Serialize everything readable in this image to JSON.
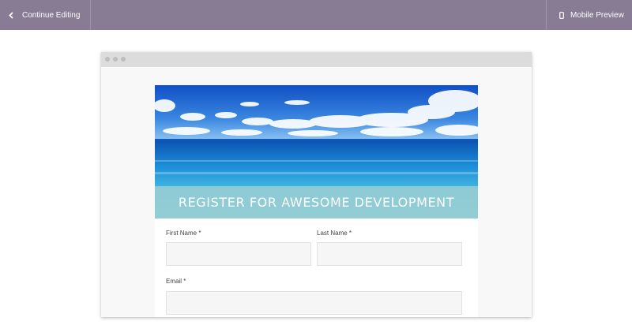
{
  "topbar": {
    "continue_label": "Continue Editing",
    "mobile_label": "Mobile Preview",
    "background": "#877c94",
    "left_icon": "chevron-left-icon",
    "right_icon": "mobile-phone-icon"
  },
  "form": {
    "banner_title": "REGISTER FOR AWESOME DEVELOPMENT",
    "banner_color": "#92cbd3",
    "fields": {
      "first_name": {
        "label": "First Name *",
        "value": ""
      },
      "last_name": {
        "label": "Last Name *",
        "value": ""
      },
      "email": {
        "label": "Email *",
        "value": ""
      }
    }
  }
}
